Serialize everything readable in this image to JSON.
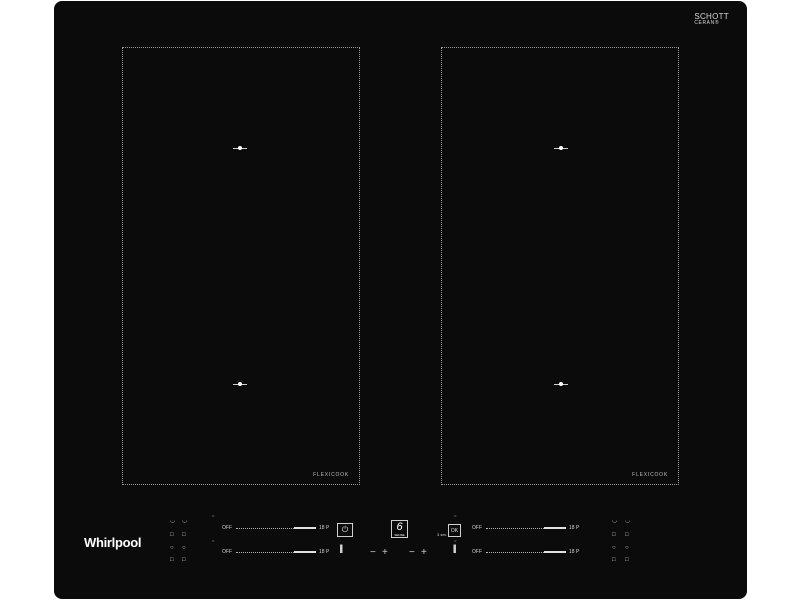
{
  "brand": {
    "glass_line1": "SCHOTT",
    "glass_line2": "CERAN®",
    "maker": "Whirlpool"
  },
  "zones": [
    {
      "label": "FLEXICOOK"
    },
    {
      "label": "FLEXICOOK"
    }
  ],
  "controls": {
    "sliders": [
      {
        "off_label": "OFF",
        "max_label": "18 P"
      },
      {
        "off_label": "OFF",
        "max_label": "18 P"
      },
      {
        "off_label": "OFF",
        "max_label": "18 P"
      },
      {
        "off_label": "OFF",
        "max_label": "18 P"
      }
    ],
    "power_symbol": "⏻",
    "sixth_sense_number": "6",
    "sixth_sense_caption": "SENSE",
    "minus": "−",
    "plus": "+",
    "lock_label": "3 sec",
    "ok_label": "OK"
  },
  "icons": {
    "left_cooking": [
      "pot-icon",
      "pan-icon",
      "boil-icon",
      "simmer-icon",
      "fry-icon",
      "melt-icon",
      "keep-warm-icon",
      "grill-icon"
    ],
    "right_cooking": [
      "pot-icon",
      "pan-icon",
      "boil-icon",
      "simmer-icon",
      "fry-icon",
      "melt-icon",
      "keep-warm-icon",
      "grill-icon"
    ]
  },
  "colors": {
    "glass": "#0b0b0b",
    "markings": "#cfcfcf"
  }
}
